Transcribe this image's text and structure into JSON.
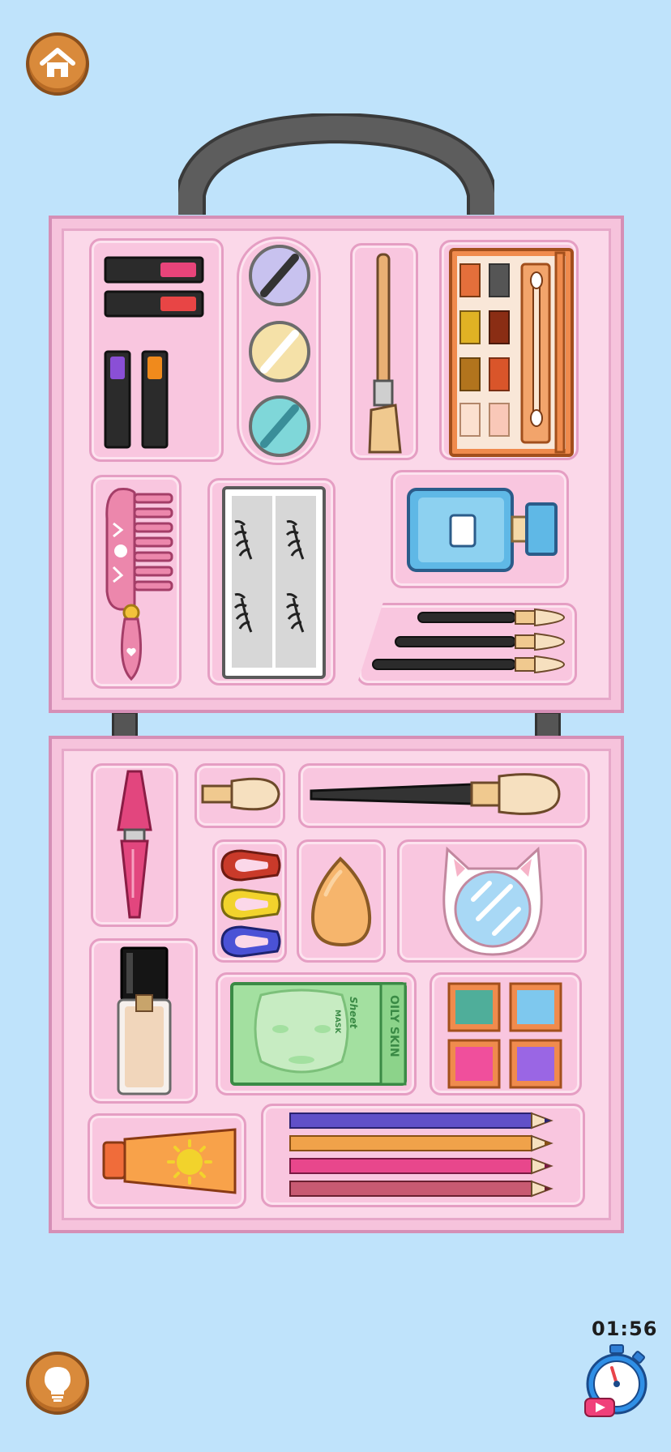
{
  "timer": {
    "value": "01:56"
  },
  "mask": {
    "label": "OILY SKIN",
    "sub": "MASK",
    "brand": "Sheet"
  },
  "icons": {
    "home": "home-icon",
    "hint": "lightbulb-icon",
    "stopwatch": "stopwatch-video-icon"
  },
  "colors": {
    "background": "#bfe3fb",
    "case": "#f6c3dc",
    "button": "#d98a3b"
  }
}
